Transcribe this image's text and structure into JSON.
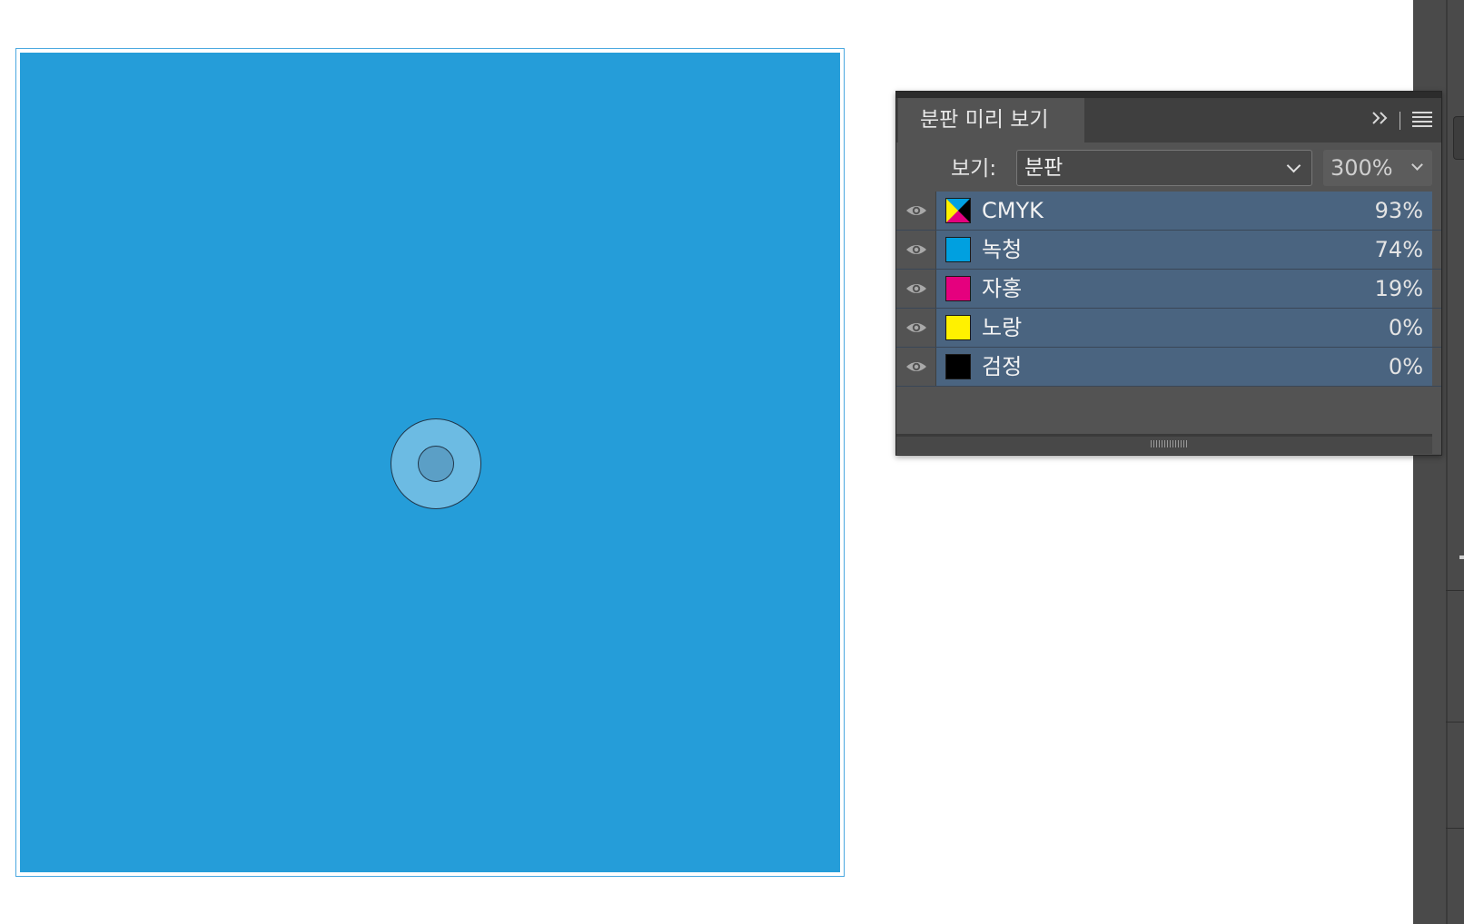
{
  "panel": {
    "title": "분판 미리 보기",
    "view_label": "보기:",
    "view_value": "분판",
    "zoom_value": "300%",
    "collapse_icon": "double-chevron-right-icon",
    "menu_icon": "hamburger-menu-icon"
  },
  "separations": [
    {
      "name": "CMYK",
      "percent": "93%",
      "swatch": "cmyk"
    },
    {
      "name": "녹청",
      "percent": "74%",
      "swatch": "#00a0e0"
    },
    {
      "name": "자홍",
      "percent": "19%",
      "swatch": "#e5007e"
    },
    {
      "name": "노랑",
      "percent": "0%",
      "swatch": "#fff100"
    },
    {
      "name": "검정",
      "percent": "0%",
      "swatch": "#000000"
    }
  ],
  "colors": {
    "artboard_fill": "#259dd9",
    "panel_bg": "#535353",
    "row_highlight": "#4a6480"
  }
}
